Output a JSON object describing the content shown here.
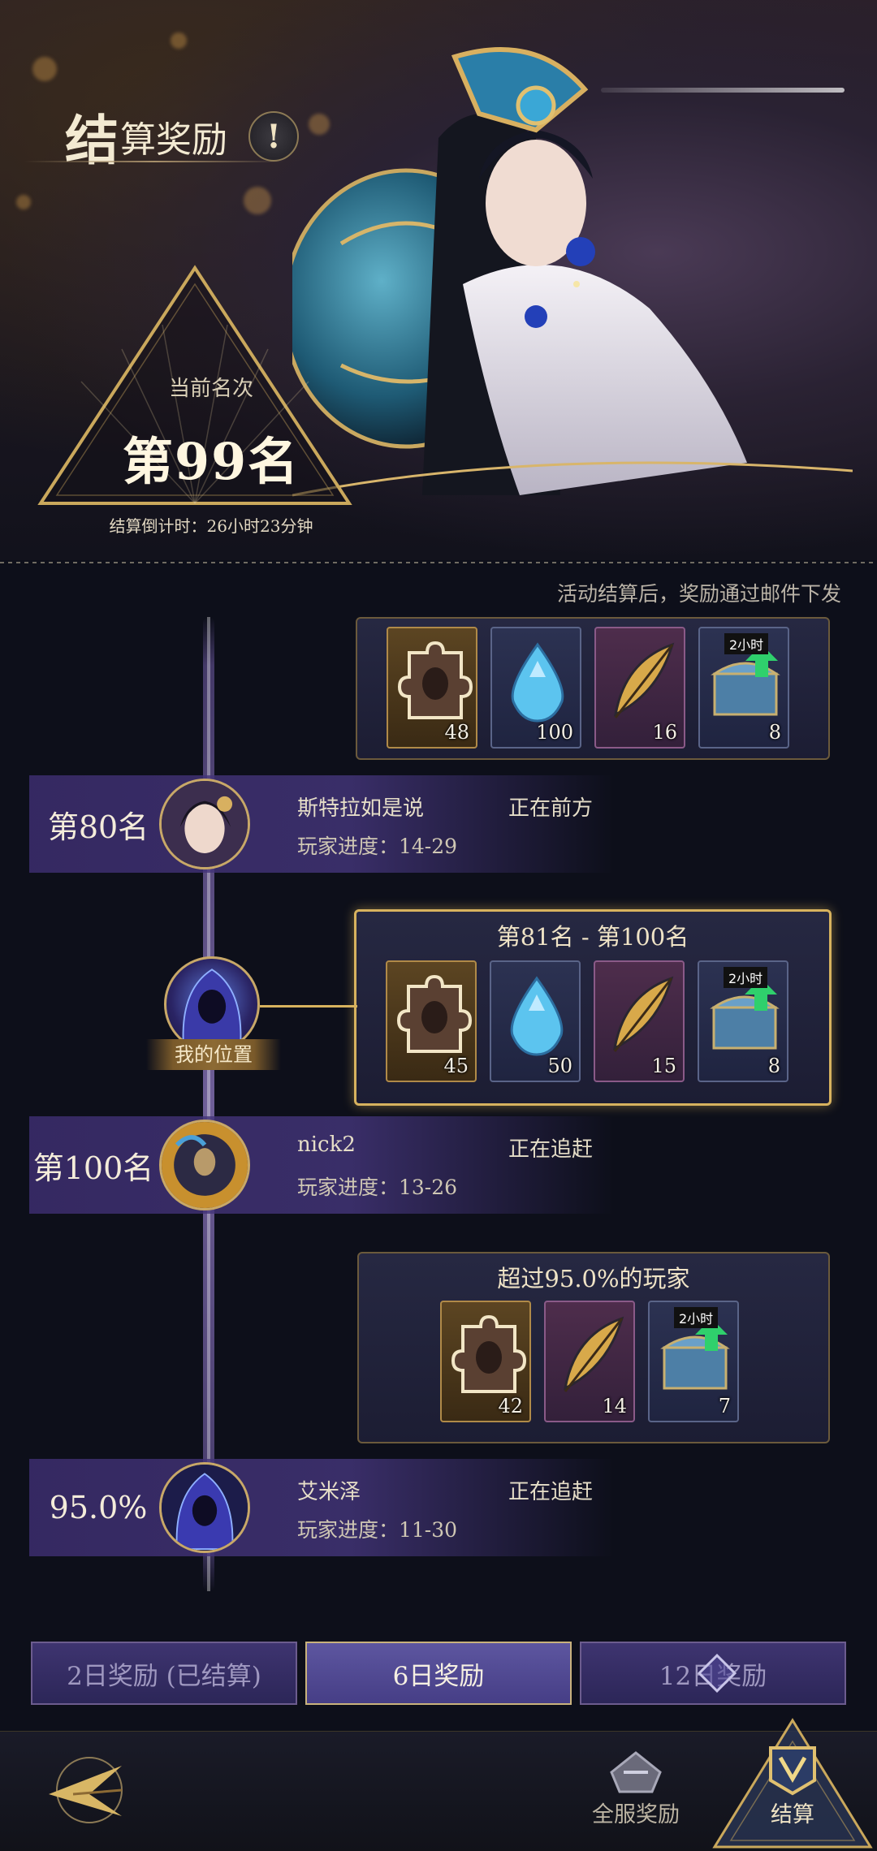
{
  "header": {
    "title_big": "结",
    "title_rest": "算奖励",
    "info_icon": "!"
  },
  "rank": {
    "label": "当前名次",
    "value": "第99名",
    "countdown": "结算倒计时：26小时23分钟"
  },
  "notice": "活动结算后，奖励通过邮件下发",
  "tiers": [
    {
      "title": "",
      "items": [
        {
          "icon": "puzzle-portrait-icon",
          "count": "48",
          "style": "gold"
        },
        {
          "icon": "blue-gem-icon",
          "count": "100",
          "style": "blue"
        },
        {
          "icon": "golden-feather-icon",
          "count": "16",
          "style": "purple"
        },
        {
          "icon": "treasure-chest-icon",
          "count": "8",
          "style": "blue",
          "tag": "2小时"
        }
      ]
    },
    {
      "title": "第81名 - 第100名",
      "items": [
        {
          "icon": "puzzle-portrait-icon",
          "count": "45",
          "style": "gold"
        },
        {
          "icon": "blue-gem-icon",
          "count": "50",
          "style": "blue"
        },
        {
          "icon": "golden-feather-icon",
          "count": "15",
          "style": "purple"
        },
        {
          "icon": "treasure-chest-icon",
          "count": "8",
          "style": "blue",
          "tag": "2小时"
        }
      ]
    },
    {
      "title": "超过95.0%的玩家",
      "items": [
        {
          "icon": "puzzle-portrait-icon",
          "count": "42",
          "style": "gold"
        },
        {
          "icon": "golden-feather-icon",
          "count": "14",
          "style": "purple"
        },
        {
          "icon": "treasure-chest-icon",
          "count": "7",
          "style": "blue",
          "tag": "2小时"
        }
      ]
    }
  ],
  "players": [
    {
      "rank": "第80名",
      "name": "斯特拉如是说",
      "status": "正在前方",
      "progress": "玩家进度：14-29"
    },
    {
      "rank": "第100名",
      "name": "nick2",
      "status": "正在追赶",
      "progress": "玩家进度：13-26"
    },
    {
      "rank": "95.0%",
      "name": "艾米泽",
      "status": "正在追赶",
      "progress": "玩家进度：11-30"
    }
  ],
  "my_position": {
    "label": "我的位置"
  },
  "tabs": [
    {
      "label": "2日奖励 (已结算)",
      "active": false
    },
    {
      "label": "6日奖励",
      "active": true
    },
    {
      "label": "12日奖励",
      "active": false,
      "locked": true
    }
  ],
  "bottom_nav": {
    "server_rewards": "全服奖励",
    "settlement": "结算"
  },
  "colors": {
    "gold_border": "#d7b25e",
    "card_bg": "#1c1d33",
    "tab_active": "#5d56a0",
    "row_purple": "#483882"
  }
}
